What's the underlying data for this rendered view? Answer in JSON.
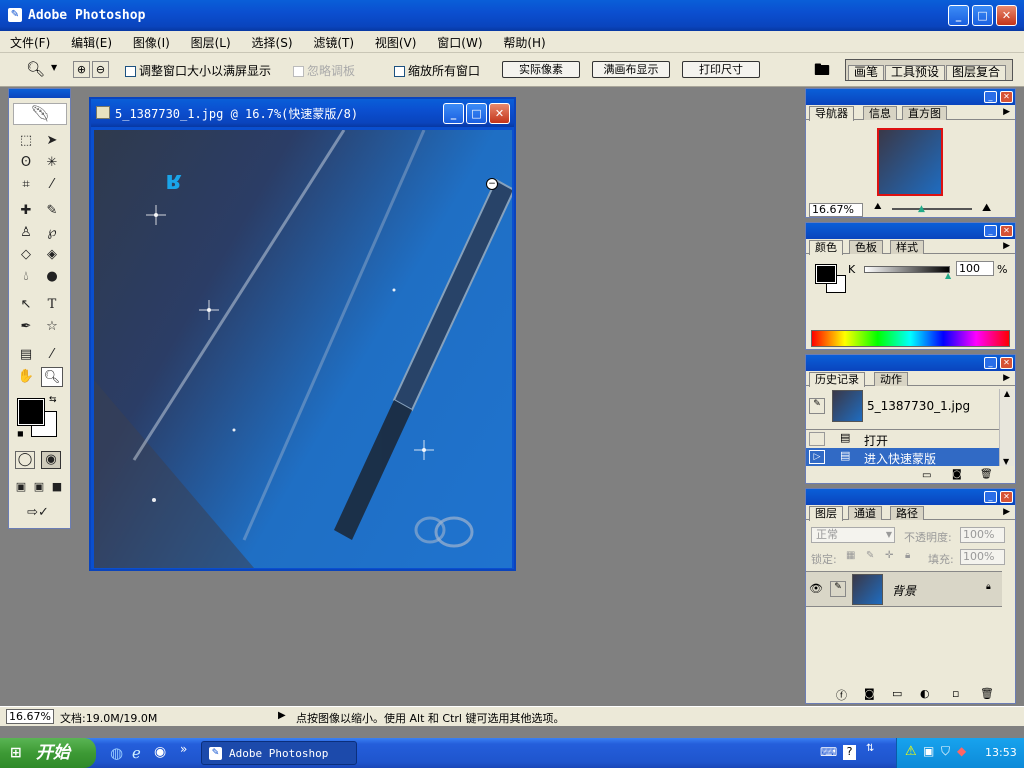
{
  "app": {
    "title": "Adobe Photoshop"
  },
  "menu": [
    "文件(F)",
    "编辑(E)",
    "图像(I)",
    "图层(L)",
    "选择(S)",
    "滤镜(T)",
    "视图(V)",
    "窗口(W)",
    "帮助(H)"
  ],
  "options": {
    "resize_windows": "调整窗口大小以满屏显示",
    "ignore_palettes": "忽略调板",
    "zoom_all": "缩放所有窗口",
    "actual_pixels": "实际像素",
    "fit_screen": "满画布显示",
    "print_size": "打印尺寸",
    "well_tabs": [
      "画笔",
      "工具预设",
      "图层复合"
    ]
  },
  "document": {
    "title": "5_1387730_1.jpg @ 16.7%(快速蒙版/8)",
    "image_text": "ʁ"
  },
  "navigator": {
    "tabs": [
      "导航器",
      "信息",
      "直方图"
    ],
    "zoom": "16.67%"
  },
  "color": {
    "tabs": [
      "颜色",
      "色板",
      "样式"
    ],
    "channel": "K",
    "value": "100",
    "unit": "%"
  },
  "history": {
    "tabs": [
      "历史记录",
      "动作"
    ],
    "snapshot": "5_1387730_1.jpg",
    "items": [
      "打开",
      "进入快速蒙版"
    ]
  },
  "layers": {
    "tabs": [
      "图层",
      "通道",
      "路径"
    ],
    "blend": "正常",
    "opacity_label": "不透明度:",
    "opacity": "100%",
    "lock_label": "锁定:",
    "fill_label": "填充:",
    "fill": "100%",
    "layer_name": "背景"
  },
  "status": {
    "zoom": "16.67%",
    "doc": "文档:19.0M/19.0M",
    "hint": "点按图像以缩小。使用 Alt 和 Ctrl 键可选用其他选项。"
  },
  "taskbar": {
    "start": "开始",
    "task": "Adobe Photoshop",
    "time": "13:53",
    "chevron": "»"
  },
  "colors": {
    "accent": "#0a5fd8",
    "panel": "#ece9d8",
    "workspace": "#808080",
    "start_green": "#3d9a35"
  }
}
